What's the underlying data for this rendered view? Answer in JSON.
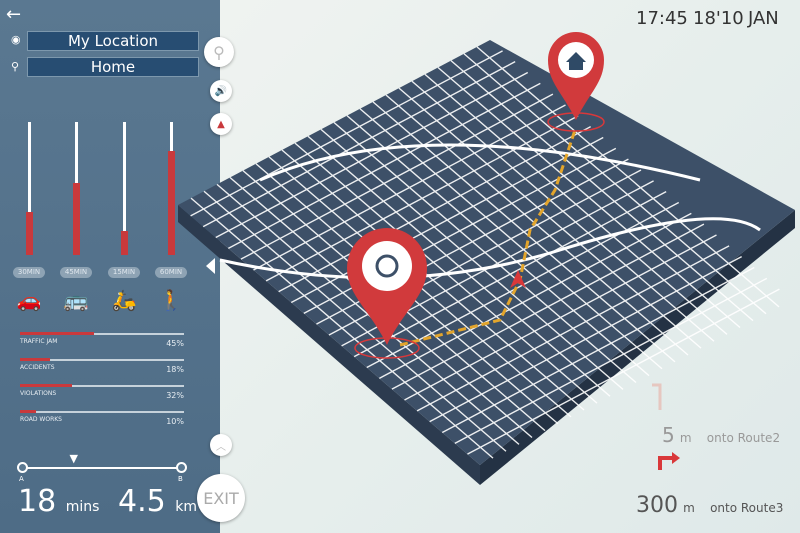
{
  "nav": {
    "back_icon": "arrow-left-icon",
    "origin": "My Location",
    "destination": "Home"
  },
  "modes": [
    {
      "label": "30MIN",
      "icon": "car-icon",
      "glyph": "🚗",
      "level": 0.32
    },
    {
      "label": "45MIN",
      "icon": "bus-icon",
      "glyph": "🚌",
      "level": 0.54
    },
    {
      "label": "15MIN",
      "icon": "scooter-icon",
      "glyph": "🛵",
      "level": 0.18
    },
    {
      "label": "60MIN",
      "icon": "walk-icon",
      "glyph": "🚶",
      "level": 0.78
    }
  ],
  "stats": [
    {
      "label": "TRAFFIC JAM",
      "value": "45%",
      "fraction": 0.45
    },
    {
      "label": "ACCIDENTS",
      "value": "18%",
      "fraction": 0.18
    },
    {
      "label": "VIOLATIONS",
      "value": "32%",
      "fraction": 0.32
    },
    {
      "label": "ROAD WORKS",
      "value": "10%",
      "fraction": 0.1
    }
  ],
  "route": {
    "start": "A",
    "end": "B",
    "progress": 0.33,
    "time": "18",
    "time_unit": "mins",
    "distance": "4.5",
    "distance_unit": "km"
  },
  "buttons": {
    "exit": "EXIT"
  },
  "header": {
    "time": "17:45",
    "date": "18'10",
    "month": "JAN"
  },
  "directions": [
    {
      "distance": "5",
      "unit": "m",
      "text": "onto Route2"
    },
    {
      "distance": "300",
      "unit": "m",
      "text": "onto Route3"
    }
  ],
  "colors": {
    "panel": "#5a7891",
    "accent": "#c9393c",
    "map": "#3d5068"
  }
}
